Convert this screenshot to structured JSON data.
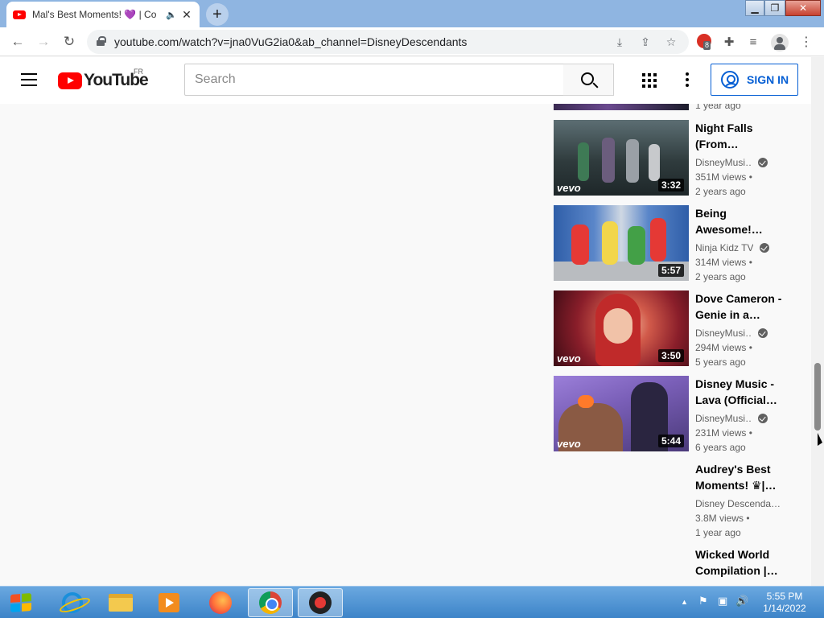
{
  "browser": {
    "tab_title": "Mal's Best Moments! 💜 | Co",
    "url": "youtube.com/watch?v=jna0VuG2ia0&ab_channel=DisneyDescendants",
    "extension_badge": "8"
  },
  "youtube": {
    "logo_text": "YouTube",
    "region": "FR",
    "search_placeholder": "Search",
    "sign_in": "SIGN IN"
  },
  "top_partial": {
    "ago": "1 year ago"
  },
  "videos": [
    {
      "title1": "Night Falls",
      "title2": "(From…",
      "channel": "DisneyMusi…",
      "verified": true,
      "views": "351M views •",
      "ago": "2 years ago",
      "duration": "3:32",
      "vevo": "vevo"
    },
    {
      "title1": "Being",
      "title2": "Awesome!…",
      "channel": "Ninja Kidz TV",
      "verified": true,
      "views": "314M views •",
      "ago": "2 years ago",
      "duration": "5:57",
      "vevo": ""
    },
    {
      "title1": "Dove Cameron -",
      "title2": "Genie in a…",
      "channel": "DisneyMusi…",
      "verified": true,
      "views": "294M views •",
      "ago": "5 years ago",
      "duration": "3:50",
      "vevo": "vevo"
    },
    {
      "title1": "Disney Music -",
      "title2": "Lava (Official…",
      "channel": "DisneyMusi…",
      "verified": true,
      "views": "231M views •",
      "ago": "6 years ago",
      "duration": "5:44",
      "vevo": "vevo"
    },
    {
      "title1": "Audrey's Best",
      "title2": "Moments! ♛|…",
      "channel": "Disney Descenda…",
      "verified": false,
      "views": "3.8M views •",
      "ago": "1 year ago",
      "duration": "",
      "vevo": ""
    },
    {
      "title1": "Wicked World",
      "title2": "Compilation |…",
      "channel": "",
      "verified": false,
      "views": "",
      "ago": "",
      "duration": "",
      "vevo": ""
    }
  ],
  "taskbar": {
    "time": "5:55 PM",
    "date": "1/14/2022"
  }
}
